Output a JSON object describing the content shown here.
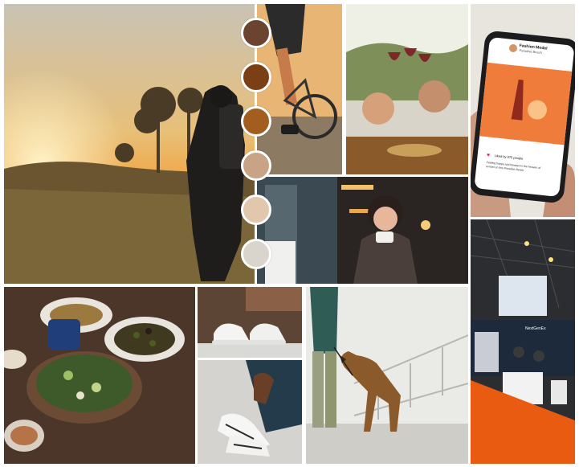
{
  "palette": {
    "swatches": [
      {
        "color": "#6b4331"
      },
      {
        "color": "#7a3f14"
      },
      {
        "color": "#a35d1e"
      },
      {
        "color": "#c9a385"
      },
      {
        "color": "#e1c8ad"
      },
      {
        "color": "#d9d4cc"
      }
    ]
  },
  "phone_post": {
    "username": "Fashion Model",
    "location": "Paradise Beach",
    "likes": "Liked by 875 people",
    "caption": "Feeling happy and blessed in the heaven of sunset on this Paradise Beach"
  },
  "booth": {
    "brand": "NextGenEx"
  },
  "icons": {
    "avatar": "avatar-icon",
    "heart": "heart-icon"
  }
}
